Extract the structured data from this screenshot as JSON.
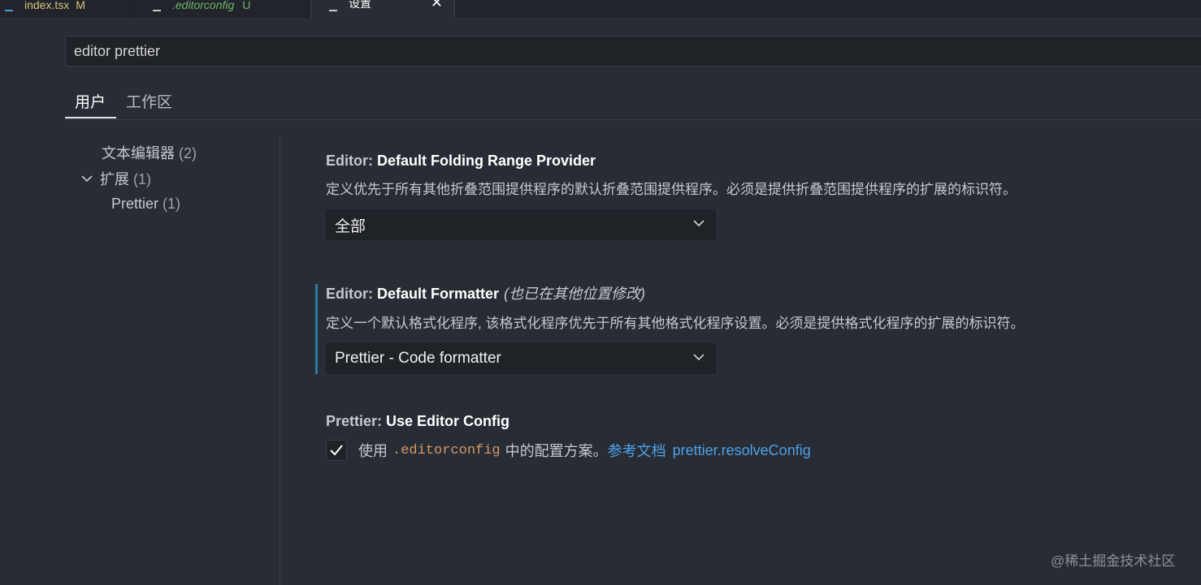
{
  "tabs": [
    {
      "name": "index.tsx",
      "badge": "M"
    },
    {
      "name": ".editorconfig",
      "badge": "U"
    },
    {
      "name": "设置",
      "close": "✕"
    }
  ],
  "search": {
    "value": "editor prettier"
  },
  "scopes": {
    "user": "用户",
    "workspace": "工作区"
  },
  "toc": {
    "text_editor": "文本编辑器",
    "text_editor_count": "(2)",
    "extensions": "扩展",
    "extensions_count": "(1)",
    "prettier": "Prettier",
    "prettier_count": "(1)"
  },
  "settings": {
    "folding": {
      "category": "Editor: ",
      "name": "Default Folding Range Provider",
      "description": "定义优先于所有其他折叠范围提供程序的默认折叠范围提供程序。必须是提供折叠范围提供程序的扩展的标识符。",
      "value": "全部"
    },
    "formatter": {
      "category": "Editor: ",
      "name": "Default Formatter",
      "note": "(也已在其他位置修改)",
      "description": "定义一个默认格式化程序, 该格式化程序优先于所有其他格式化程序设置。必须是提供格式化程序的扩展的标识符。",
      "value": "Prettier - Code formatter"
    },
    "editor_config": {
      "category": "Prettier: ",
      "name": "Use Editor Config",
      "checked": true,
      "desc_prefix": "使用",
      "desc_code": ".editorconfig",
      "desc_middle": "中的配置方案。",
      "link_docs": "参考文档",
      "link_resolve": "prettier.resolveConfig"
    }
  },
  "watermark": "@稀土掘金技术社区",
  "colors": {
    "background": "#282c34",
    "accent_bar": "#2c7ba6",
    "link": "#4ea1e8",
    "code": "#d19a66"
  }
}
